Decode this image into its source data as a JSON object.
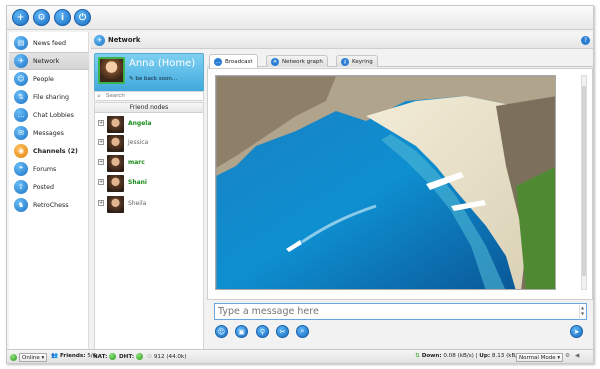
{
  "toolbar": {
    "buttons": [
      {
        "icon": "add-user-icon",
        "glyph": "+"
      },
      {
        "icon": "gear-icon",
        "glyph": "⚙"
      },
      {
        "icon": "info-icon",
        "glyph": "i"
      },
      {
        "icon": "power-icon",
        "glyph": "⏻"
      }
    ]
  },
  "sidebar": {
    "items": [
      {
        "label": "News feed",
        "icon": "news-feed-icon",
        "glyph": "▤"
      },
      {
        "label": "Network",
        "icon": "network-icon",
        "glyph": "✈",
        "active": true
      },
      {
        "label": "People",
        "icon": "people-icon",
        "glyph": "☺"
      },
      {
        "label": "File sharing",
        "icon": "file-sharing-icon",
        "glyph": "⇅"
      },
      {
        "label": "Chat Lobbies",
        "icon": "chat-lobbies-icon",
        "glyph": "…"
      },
      {
        "label": "Messages",
        "icon": "messages-icon",
        "glyph": "✉"
      },
      {
        "label": "Channels (2)",
        "icon": "channels-icon",
        "glyph": "◉",
        "bold": true
      },
      {
        "label": "Forums",
        "icon": "forums-icon",
        "glyph": "❝"
      },
      {
        "label": "Posted",
        "icon": "posted-icon",
        "glyph": "⇧"
      },
      {
        "label": "RetroChess",
        "icon": "chess-icon",
        "glyph": "♞"
      }
    ]
  },
  "header": {
    "title": "Network",
    "help": "?"
  },
  "profile": {
    "name": "Anna (Home)",
    "status": "be back soon..."
  },
  "search": {
    "placeholder": "Search"
  },
  "friends": {
    "title": "Friend nodes",
    "items": [
      {
        "name": "Angela",
        "online": true
      },
      {
        "name": "Jessica",
        "online": false
      },
      {
        "name": "marc",
        "online": true
      },
      {
        "name": "Shani",
        "online": true
      },
      {
        "name": "Sheila",
        "online": false
      }
    ]
  },
  "tabs": [
    {
      "label": "Broadcast",
      "active": true
    },
    {
      "label": "Network graph",
      "active": false
    },
    {
      "label": "Keyring",
      "active": false
    }
  ],
  "message": {
    "placeholder": "Type a message here"
  },
  "status": {
    "online_label": "Online",
    "friends_label": "Friends:",
    "friends_value": "5/6",
    "nat_label": "NAT:",
    "dht_label": "DHT:",
    "peers_value": "912",
    "peers_extra": "(44.0k)",
    "down_label": "Down:",
    "down_value": "0.08 (kB/s)",
    "up_label": "Up:",
    "up_value": "8.13 (kB/s)",
    "mode": "Normal Mode"
  }
}
